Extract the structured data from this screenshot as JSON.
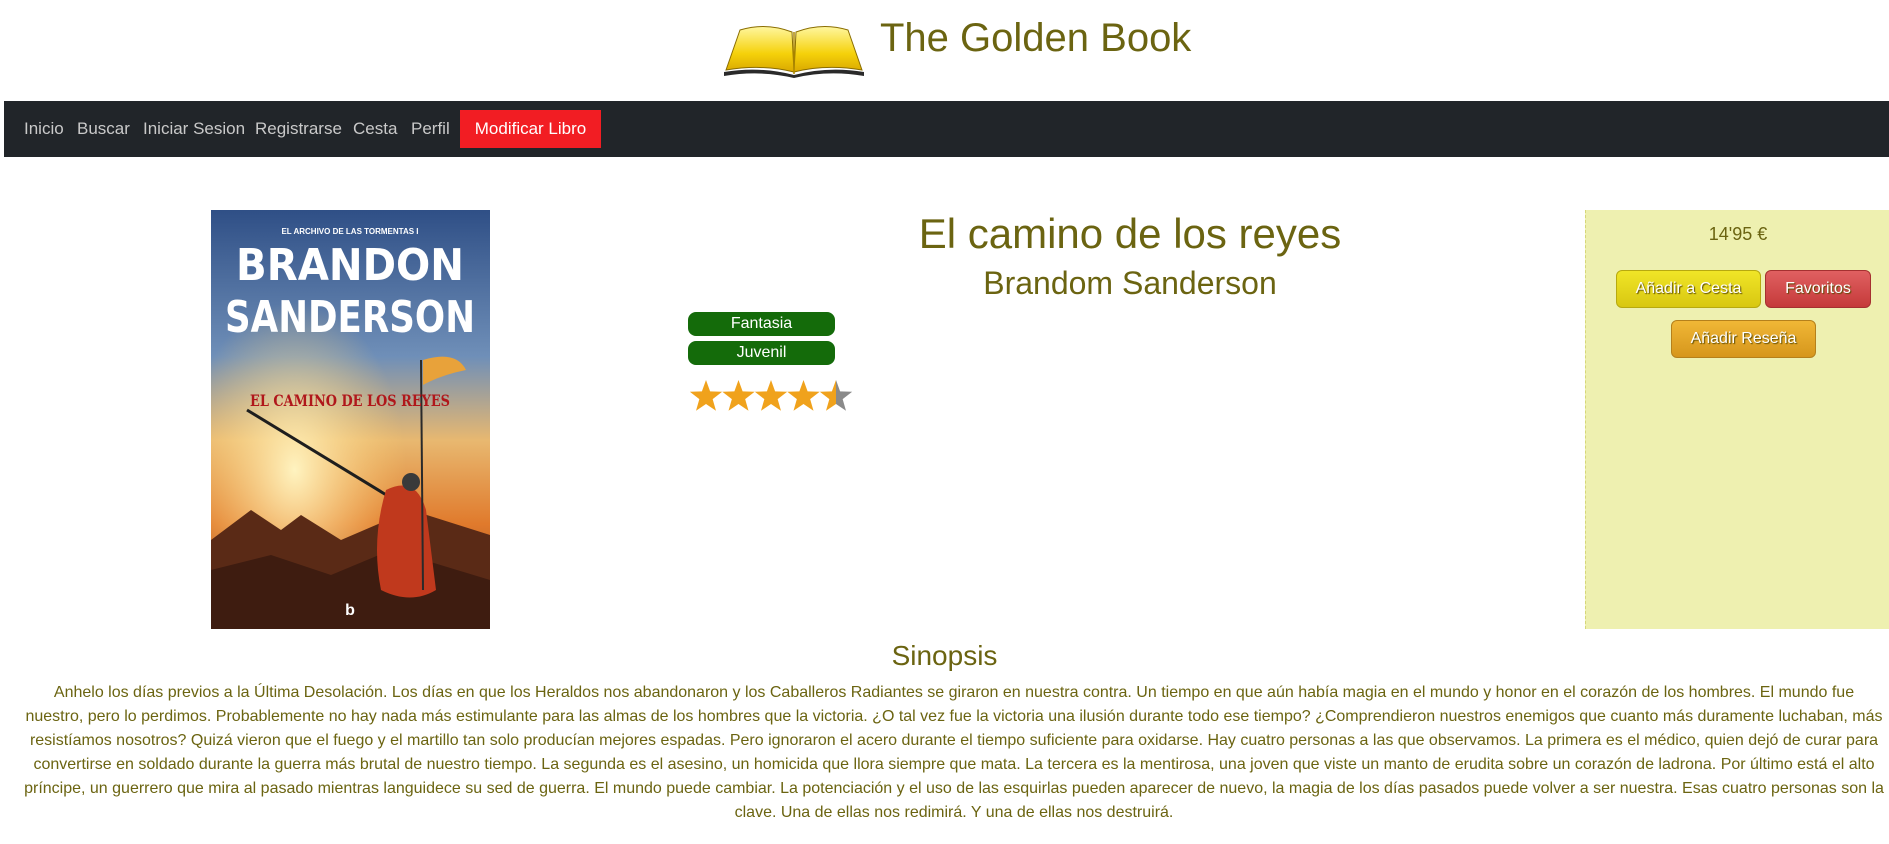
{
  "site": {
    "title": "The Golden Book"
  },
  "nav": {
    "items": [
      {
        "label": "Inicio"
      },
      {
        "label": "Buscar"
      },
      {
        "label": "Iniciar Sesion"
      },
      {
        "label": "Registrarse"
      },
      {
        "label": "Cesta"
      },
      {
        "label": "Perfil"
      }
    ],
    "active_label": "Modificar Libro",
    "active_color": "#f21d23"
  },
  "book": {
    "title": "El camino de los reyes",
    "author": "Brandom Sanderson",
    "genres": [
      {
        "label": "Fantasia"
      },
      {
        "label": "Juvenil"
      }
    ],
    "rating": 4.5,
    "rating_max": 5,
    "price": "14'95 €",
    "cover": {
      "series_label": "EL ARCHIVO DE LAS TORMENTAS I",
      "author_line1": "BRANDON",
      "author_line2": "SANDERSON",
      "title": "EL CAMINO DE LOS REYES",
      "publisher_mark": "b"
    }
  },
  "actions": {
    "add_to_cart": "Añadir a Cesta",
    "favorites": "Favoritos",
    "add_review": "Añadir Reseña"
  },
  "synopsis": {
    "heading": "Sinopsis",
    "text": "Anhelo los días previos a la Última Desolación. Los días en que los Heraldos nos abandonaron y los Caballeros Radiantes se giraron en nuestra contra. Un tiempo en que aún había magia en el mundo y honor en el corazón de los hombres. El mundo fue nuestro, pero lo perdimos. Probablemente no hay nada más estimulante para las almas de los hombres que la victoria. ¿O tal vez fue la victoria una ilusión durante todo ese tiempo? ¿Comprendieron nuestros enemigos que cuanto más duramente luchaban, más resistíamos nosotros? Quizá vieron que el fuego y el martillo tan solo producían mejores espadas. Pero ignoraron el acero durante el tiempo suficiente para oxidarse. Hay cuatro personas a las que observamos. La primera es el médico, quien dejó de curar para convertirse en soldado durante la guerra más brutal de nuestro tiempo. La segunda es el asesino, un homicida que llora siempre que mata. La tercera es la mentirosa, una joven que viste un manto de erudita sobre un corazón de ladrona. Por último está el alto príncipe, un guerrero que mira al pasado mientras languidece su sed de guerra. El mundo puede cambiar. La potenciación y el uso de las esquirlas pueden aparecer de nuevo, la magia de los días pasados puede volver a ser nuestra. Esas cuatro personas son la clave. Una de ellas nos redimirá. Y una de ellas nos destruirá."
  },
  "colors": {
    "accent_text": "#6b6411",
    "navbar_bg": "#212529",
    "genre_badge": "#146b0a",
    "side_panel_bg": "#eef0b0",
    "star": "#f0a21c"
  }
}
